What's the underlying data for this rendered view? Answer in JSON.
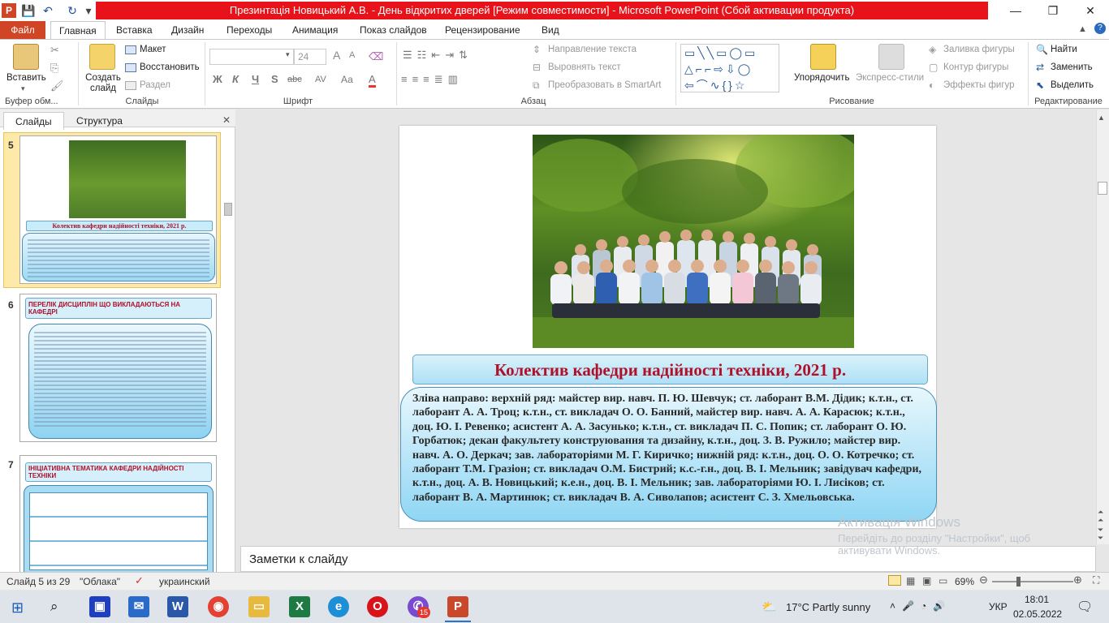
{
  "window": {
    "title": "Презинтація Новицький А.В. - День відкритих дверей [Режим совместимости] - Microsoft PowerPoint (Сбой активации продукта)",
    "app_icon": "P"
  },
  "tabs": [
    "Файл",
    "Главная",
    "Вставка",
    "Дизайн",
    "Переходы",
    "Анимация",
    "Показ слайдов",
    "Рецензирование",
    "Вид"
  ],
  "ribbon": {
    "clipboard": {
      "paste": "Вставить",
      "label": "Буфер обм..."
    },
    "slides": {
      "new_slide": "Создать слайд",
      "layout": "Макет",
      "reset": "Восстановить",
      "section": "Раздел",
      "label": "Слайды"
    },
    "font": {
      "size": "24",
      "label": "Шрифт",
      "bold": "Ж",
      "italic": "К",
      "underline": "Ч",
      "strike": "S",
      "abc": "abc",
      "aa": "Аа",
      "a": "А"
    },
    "paragraph": {
      "text_direction": "Направление текста",
      "align_text": "Выровнять текст",
      "smartart": "Преобразовать в SmartArt",
      "label": "Абзац"
    },
    "drawing": {
      "arrange": "Упорядочить",
      "quick_styles": "Экспресс-стили",
      "fill": "Заливка фигуры",
      "outline": "Контур фигуры",
      "effects": "Эффекты фигур",
      "label": "Рисование"
    },
    "editing": {
      "find": "Найти",
      "replace": "Заменить",
      "select": "Выделить",
      "label": "Редактирование"
    }
  },
  "pane": {
    "tab_slides": "Слайды",
    "tab_outline": "Структура",
    "close": "✕"
  },
  "thumbnails": [
    {
      "num": "5",
      "title": "Колектив кафедри надійності техніки, 2021 р."
    },
    {
      "num": "6",
      "title": "ПЕРЕЛІК ДИСЦИПЛІН ЩО ВИКЛАДАЮТЬСЯ НА КАФЕДРІ"
    },
    {
      "num": "7",
      "title": "ІНІЦІАТИВНА ТЕМАТИКА КАФЕДРИ НАДІЙНОСТІ ТЕХНІКИ"
    }
  ],
  "slide": {
    "caption": "Колектив кафедри надійності техніки, 2021 р.",
    "description": "Зліва направо: верхній ряд: майстер вир. навч. П. Ю. Шевчук; ст. лаборант В.М. Дідик; к.т.н., ст. лаборант А. А. Троц; к.т.н., ст. викладач О. О. Банний, майстер вир. навч. А. А. Карасюк; к.т.н., доц. Ю. І. Ревенко; асистент А. А. Засунько; к.т.н., ст. викладач П. С. Попик; ст. лаборант О. Ю. Горбатюк; декан факультету конструювання та дизайну, к.т.н., доц. З. В. Ружило; майстер вир. навч. А. О. Деркач; зав. лабораторіями М. Г. Киричко; нижній ряд: к.т.н., доц. О. О. Котречко; ст. лаборант Т.М. Гразіон; ст. викладач О.М. Бистрий; к.с.-г.н., доц. В. І. Мельник; завідувач кафедри, к.т.н., доц. А. В. Новицький; к.е.н., доц. В. І. Мельник; зав. лабораторіями Ю. І. Лисіков; ст. лаборант В. А. Мартинюк; ст. викладач В. А. Сиволапов; асистент С. З. Хмельовська."
  },
  "notes_placeholder": "Заметки к слайду",
  "watermark": {
    "line1": "Активація Windows",
    "line2": "Перейдіть до розділу \"Настройки\", щоб активувати Windows."
  },
  "status": {
    "slide_info": "Слайд 5 из 29",
    "theme": "\"Облака\"",
    "language": "украинский",
    "zoom": "69%"
  },
  "taskbar": {
    "weather": "17°C  Partly sunny",
    "lang": "УКР",
    "time": "18:01",
    "date": "02.05.2022",
    "badge": "15"
  },
  "colors": {
    "accent_red": "#e8131a",
    "file_tab": "#d04525",
    "caption_text": "#b0102a"
  }
}
